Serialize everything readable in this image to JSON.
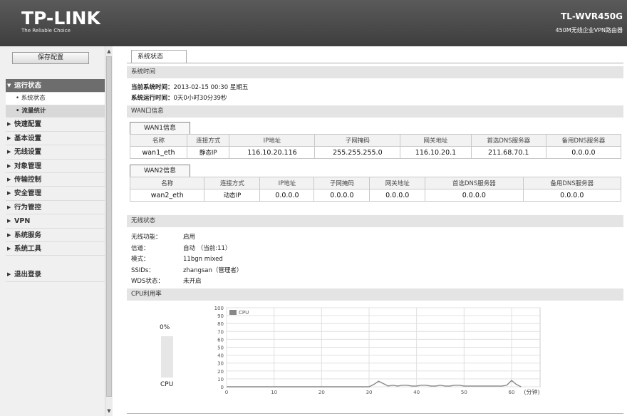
{
  "header": {
    "logo": "TP-LINK",
    "tagline": "The Reliable Choice",
    "model": "TL-WVR450G",
    "model_desc": "450M无线企业VPN路由器"
  },
  "sidebar": {
    "save_label": "保存配置",
    "menu": [
      {
        "label": "运行状态",
        "expanded": true,
        "active": true,
        "children": [
          {
            "label": "系统状态",
            "selected": false
          },
          {
            "label": "流量统计",
            "selected": true
          }
        ]
      },
      {
        "label": "快速配置"
      },
      {
        "label": "基本设置"
      },
      {
        "label": "无线设置"
      },
      {
        "label": "对象管理"
      },
      {
        "label": "传输控制"
      },
      {
        "label": "安全管理"
      },
      {
        "label": "行为管控"
      },
      {
        "label": "VPN"
      },
      {
        "label": "系统服务"
      },
      {
        "label": "系统工具"
      }
    ],
    "logout": "退出登录"
  },
  "main": {
    "tab": "系统状态",
    "system_time": {
      "heading": "系统时间",
      "current_label": "当前系统时间：",
      "current_value": "2013-02-15 00:30 星期五",
      "uptime_label": "系统运行时间：",
      "uptime_value": "0天0小时30分39秒"
    },
    "wan": {
      "heading": "WAN口信息",
      "columns": [
        "名称",
        "连接方式",
        "IP地址",
        "子网掩码",
        "网关地址",
        "首选DNS服务器",
        "备用DNS服务器"
      ],
      "tables": [
        {
          "tab": "WAN1信息",
          "row": [
            "wan1_eth",
            "静态IP",
            "116.10.20.116",
            "255.255.255.0",
            "116.10.20.1",
            "211.68.70.1",
            "0.0.0.0"
          ]
        },
        {
          "tab": "WAN2信息",
          "row": [
            "wan2_eth",
            "动态IP",
            "0.0.0.0",
            "0.0.0.0",
            "0.0.0.0",
            "0.0.0.0",
            "0.0.0.0"
          ]
        }
      ]
    },
    "wireless": {
      "heading": "无线状态",
      "rows": [
        {
          "k": "无线功能：",
          "v": "启用"
        },
        {
          "k": "信道：",
          "v": "自动 （当前:11）"
        },
        {
          "k": "模式：",
          "v": "11bgn mixed"
        },
        {
          "k": "SSIDs：",
          "v": "zhangsan（管理者）"
        },
        {
          "k": "WDS状态：",
          "v": "未开启"
        }
      ]
    },
    "cpu": {
      "heading": "CPU利用率",
      "percent_text": "0%",
      "gauge_label": "CPU",
      "usage_fraction": 0.0
    }
  },
  "chart_data": {
    "type": "line",
    "series": [
      {
        "name": "CPU",
        "x": [
          0,
          30,
          31,
          32,
          33,
          34,
          35,
          36,
          37,
          38,
          39,
          40,
          41,
          42,
          43,
          44,
          45,
          46,
          47,
          48,
          49,
          50,
          51,
          52,
          53,
          54,
          55,
          56,
          57,
          58,
          59,
          60,
          61,
          62
        ],
        "y": [
          0,
          0,
          3,
          7,
          4,
          1,
          2,
          1,
          2,
          2,
          1,
          1,
          2,
          2,
          1,
          1,
          2,
          1,
          1,
          2,
          2,
          1,
          1,
          1,
          1,
          1,
          1,
          1,
          1,
          1,
          2,
          8,
          3,
          0
        ]
      }
    ],
    "xticks": [
      0,
      10,
      20,
      30,
      40,
      50,
      60
    ],
    "yticks": [
      0,
      10,
      20,
      30,
      40,
      50,
      60,
      70,
      80,
      90,
      100
    ],
    "xunit": "(分钟)",
    "xlim": [
      0,
      66
    ],
    "ylim": [
      0,
      100
    ],
    "grid": true,
    "legend": "top-left",
    "color": "#888888"
  }
}
